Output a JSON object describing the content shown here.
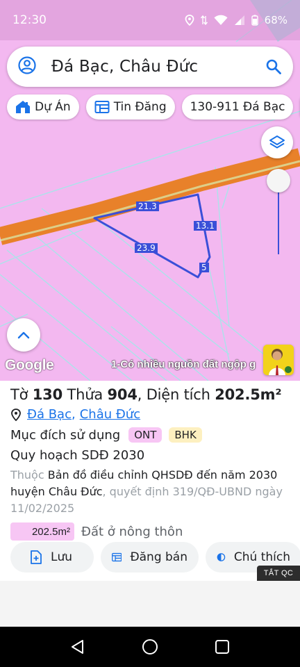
{
  "status_bar": {
    "time": "12:30",
    "battery": "68%"
  },
  "search": {
    "query": "Đá Bạc, Châu Đức"
  },
  "chips": [
    {
      "label": "Dự Án",
      "icon": "house-icon"
    },
    {
      "label": "Tin Đăng",
      "icon": "listing-icon"
    },
    {
      "label": "130-911 Đá Bạc",
      "icon": ""
    }
  ],
  "map": {
    "edge_labels": [
      "21.3",
      "13.1",
      "23.9",
      "5"
    ],
    "attribution": "Google",
    "ticker": "1-Có nhiều nguồn đất ngộp g",
    "colors": {
      "land": "#f3b8f0",
      "road": "#e8812a",
      "parcel": "#3a4fd8",
      "lines": "#9fe3e8"
    }
  },
  "parcel": {
    "title_prefix": "Tờ",
    "sheet_no": "130",
    "plot_prefix": "Thửa",
    "plot_no": "904",
    "area_prefix": ", Diện tích",
    "area": "202.5m²",
    "location_commune": "Đá Bạc",
    "location_district": "Châu Đức",
    "purpose_label": "Mục đích sử dụng",
    "purpose_tags": [
      "ONT",
      "BHK"
    ],
    "plan_heading": "Quy hoạch SDĐ 2030",
    "plan_desc_prefix": "Thuộc",
    "plan_desc_main": "Bản đồ điều chỉnh QHSDĐ đến năm 2030 huyện Châu Đức",
    "plan_desc_decision": ", quyết định 319/QĐ-UBND ngày 11/02/2025",
    "zone_area": "202.5m²",
    "zone_label": "Đất ở nông thôn"
  },
  "actions": {
    "save": "Lưu",
    "sell": "Đăng bán",
    "legend": "Chú thích"
  },
  "ad": {
    "close_label": "TẮT QC"
  }
}
